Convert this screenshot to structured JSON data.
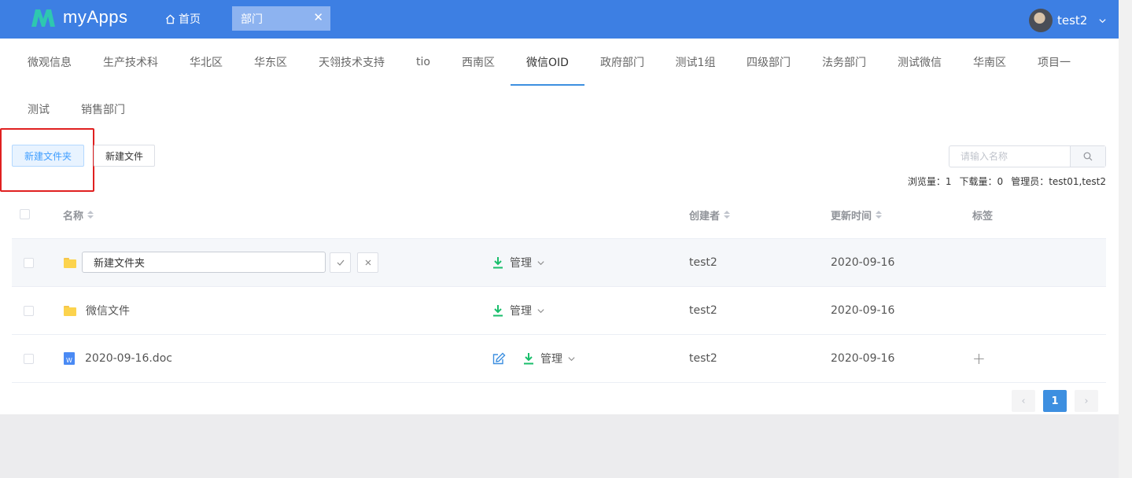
{
  "app": {
    "name": "myApps",
    "brand_color": "#3d7fe3"
  },
  "topbar": {
    "home_label": "首页",
    "open_tab": {
      "label": "部门",
      "close": "✕"
    },
    "user": {
      "name": "test2"
    }
  },
  "dept_tabs": [
    "微观信息",
    "生产技术科",
    "华北区",
    "华东区",
    "天翎技术支持",
    "tio",
    "西南区",
    "微信OID",
    "政府部门",
    "测试1组",
    "四级部门",
    "法务部门",
    "测试微信",
    "华南区",
    "项目一",
    "测试",
    "销售部门"
  ],
  "active_dept_tab": "微信OID",
  "toolbar": {
    "new_folder": "新建文件夹",
    "new_file": "新建文件"
  },
  "search": {
    "placeholder": "请输入名称"
  },
  "stats": {
    "views": "浏览量：1",
    "downloads": "下载量：0",
    "admins": "管理员：test01,test2"
  },
  "table": {
    "headers": {
      "name": "名称",
      "creator": "创建者",
      "updated": "更新时间",
      "tags": "标签"
    },
    "manage_label": "管理",
    "rows": [
      {
        "type": "folder",
        "name": "新建文件夹",
        "editing": true,
        "creator": "test2",
        "updated": "2020-09-16"
      },
      {
        "type": "folder",
        "name": "微信文件",
        "creator": "test2",
        "updated": "2020-09-16"
      },
      {
        "type": "doc",
        "name": "2020-09-16.doc",
        "icon_letter": "W",
        "creator": "test2",
        "updated": "2020-09-16",
        "tag_add": "+"
      }
    ]
  },
  "pagination": {
    "prev": "‹",
    "current": "1",
    "next": "›"
  }
}
